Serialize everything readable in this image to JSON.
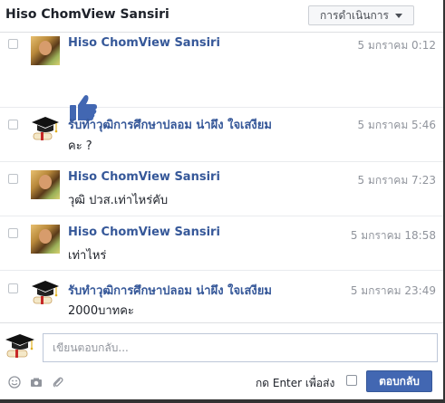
{
  "header": {
    "title": "Hiso ChomView Sansiri",
    "actions_label": "การดำเนินการ"
  },
  "messages": [
    {
      "sender": "Hiso ChomView Sansiri",
      "time": "5 มกราคม 0:12",
      "body": "",
      "avatar": "profile-photo",
      "attachment": "like-thumbs-up"
    },
    {
      "sender": "รับทำวุฒิการศึกษาปลอม น่าผึง ใจเสงียม",
      "time": "5 มกราคม 5:46",
      "body": "คะ ?",
      "avatar": "graduation-cap-diploma"
    },
    {
      "sender": "Hiso ChomView Sansiri",
      "time": "5 มกราคม 7:23",
      "body": "วุฒิ ปวส.เท่าไหร่คับ",
      "avatar": "profile-photo"
    },
    {
      "sender": "Hiso ChomView Sansiri",
      "time": "5 มกราคม 18:58",
      "body": "เท่าไหร่",
      "avatar": "profile-photo"
    },
    {
      "sender": "รับทำวุฒิการศึกษาปลอม น่าผึง ใจเสงียม",
      "time": "5 มกราคม 23:49",
      "body": "2000บาทคะ",
      "avatar": "graduation-cap-diploma"
    }
  ],
  "composer": {
    "placeholder": "เขียนตอบกลับ...",
    "value": "",
    "enter_to_send_label": "กด Enter เพื่อส่ง",
    "enter_to_send_checked": false,
    "reply_button_label": "ตอบกลับ",
    "tools": [
      "emoji-icon",
      "camera-icon",
      "paperclip-icon"
    ]
  },
  "colors": {
    "link": "#365899",
    "primary_button": "#4267b2",
    "like_blue": "#4267b2",
    "muted_text": "#90949c"
  }
}
